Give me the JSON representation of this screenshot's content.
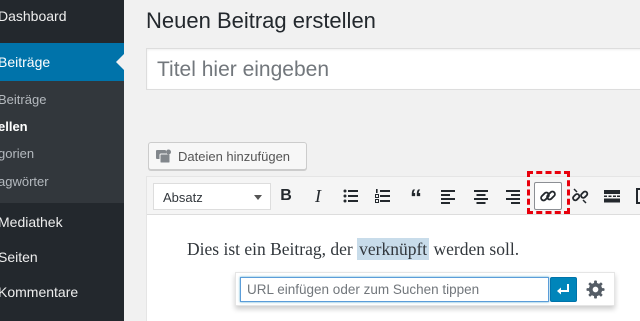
{
  "sidebar": {
    "dashboard": "Dashboard",
    "posts": "Beiträge",
    "submenu": [
      "Beiträge",
      "ellen",
      "gorien",
      "agwörter"
    ],
    "media": "Mediathek",
    "pages": "Seiten",
    "comments": "Kommentare"
  },
  "main": {
    "page_title": "Neuen Beitrag erstellen",
    "title_placeholder": "Titel hier eingeben",
    "add_media_label": "Dateien hinzufügen"
  },
  "editor": {
    "format_select_value": "Absatz",
    "toolbar_buttons": [
      "bold-icon",
      "italic-icon",
      "bulleted-list-icon",
      "numbered-list-icon",
      "blockquote-icon",
      "align-left-icon",
      "align-center-icon",
      "align-right-icon",
      "link-icon",
      "unlink-icon",
      "read-more-icon",
      "toolbar-toggle-icon"
    ],
    "content_before": "Dies ist ein Beitrag, der ",
    "content_selected": "verknüpft",
    "content_after": " werden soll.",
    "link_popup": {
      "url_placeholder": "URL einfügen oder zum Suchen tippen"
    }
  },
  "colors": {
    "sidebar_bg": "#23282d",
    "active_menu": "#0073aa",
    "highlight": "#e8000c",
    "apply_button": "#0085ba",
    "selection": "#c8dcea"
  }
}
